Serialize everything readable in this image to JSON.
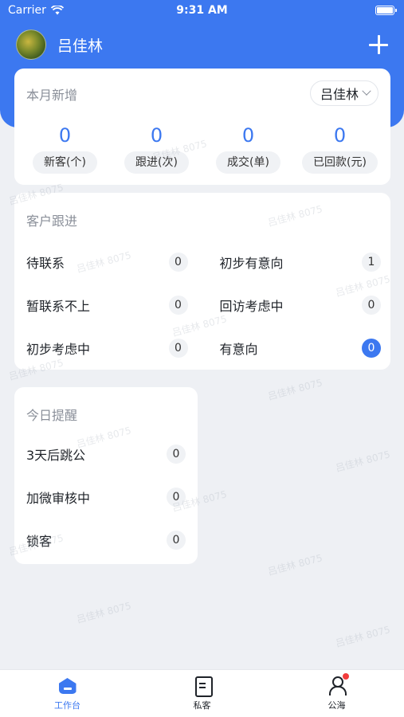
{
  "status_bar": {
    "carrier": "Carrier",
    "time": "9:31 AM"
  },
  "user": {
    "name": "吕佳林"
  },
  "monthly": {
    "title": "本月新增",
    "picker_value": "吕佳林",
    "stats": [
      {
        "value": "0",
        "label": "新客(个)"
      },
      {
        "value": "0",
        "label": "跟进(次)"
      },
      {
        "value": "0",
        "label": "成交(单)"
      },
      {
        "value": "0",
        "label": "已回款(元)"
      }
    ]
  },
  "follow": {
    "title": "客户跟进",
    "items": [
      {
        "label": "待联系",
        "count": "0"
      },
      {
        "label": "初步有意向",
        "count": "1"
      },
      {
        "label": "暂联系不上",
        "count": "0"
      },
      {
        "label": "回访考虑中",
        "count": "0"
      },
      {
        "label": "初步考虑中",
        "count": "0"
      },
      {
        "label": "有意向",
        "count": "0"
      }
    ]
  },
  "remind": {
    "title": "今日提醒",
    "items": [
      {
        "label": "3天后跳公",
        "count": "0"
      },
      {
        "label": "加微审核中",
        "count": "0"
      },
      {
        "label": "锁客",
        "count": "0"
      }
    ]
  },
  "tabs": [
    {
      "label": "工作台",
      "icon": "home-icon",
      "active": true
    },
    {
      "label": "私客",
      "icon": "document-icon",
      "active": false
    },
    {
      "label": "公海",
      "icon": "person-icon",
      "active": false
    }
  ],
  "watermark": "吕佳林 8075",
  "colors": {
    "accent": "#3c78f0",
    "badge": "#f23c3c"
  }
}
